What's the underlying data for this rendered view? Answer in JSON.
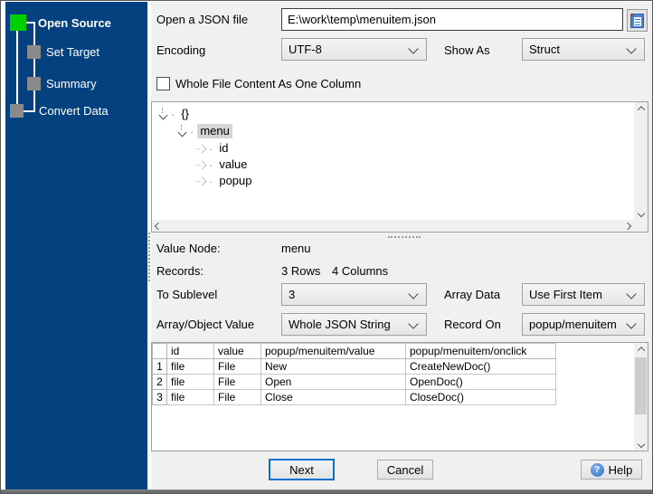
{
  "sidebar": {
    "steps": [
      {
        "label": "Open Source",
        "state": "active"
      },
      {
        "label": "Set Target",
        "state": "pending"
      },
      {
        "label": "Summary",
        "state": "pending"
      },
      {
        "label": "Convert Data",
        "state": "pending"
      }
    ]
  },
  "source": {
    "file_label": "Open a JSON file",
    "file_path": "E:\\work\\temp\\menuitem.json",
    "encoding_label": "Encoding",
    "encoding_value": "UTF-8",
    "show_as_label": "Show As",
    "show_as_value": "Struct",
    "whole_file_label": "Whole File Content As One Column",
    "whole_file_checked": false
  },
  "tree": {
    "nodes": [
      {
        "label": "{}",
        "level": 0,
        "state": "expanded",
        "selected": false
      },
      {
        "label": "menu",
        "level": 1,
        "state": "expanded",
        "selected": true
      },
      {
        "label": "id",
        "level": 2,
        "state": "collapsed",
        "selected": false
      },
      {
        "label": "value",
        "level": 2,
        "state": "collapsed",
        "selected": false
      },
      {
        "label": "popup",
        "level": 2,
        "state": "collapsed",
        "selected": false
      }
    ]
  },
  "details": {
    "value_node_label": "Value Node:",
    "value_node": "menu",
    "records_label": "Records:",
    "records_rows": "3 Rows",
    "records_columns": "4 Columns"
  },
  "options": {
    "to_sublevel_label": "To Sublevel",
    "to_sublevel_value": "3",
    "array_data_label": "Array Data",
    "array_data_value": "Use First Item",
    "array_object_label": "Array/Object Value",
    "array_object_value": "Whole JSON String",
    "record_on_label": "Record On",
    "record_on_value": "popup/menuitem"
  },
  "grid": {
    "headers": [
      "id",
      "value",
      "popup/menuitem/value",
      "popup/menuitem/onclick"
    ],
    "rows": [
      [
        "1",
        "file",
        "File",
        "New",
        "CreateNewDoc()"
      ],
      [
        "2",
        "file",
        "File",
        "Open",
        "OpenDoc()"
      ],
      [
        "3",
        "file",
        "File",
        "Close",
        "CloseDoc()"
      ]
    ]
  },
  "footer": {
    "next_label": "Next",
    "cancel_label": "Cancel",
    "help_label": "Help",
    "help_icon_glyph": "?"
  },
  "colors": {
    "sidebar_bg": "#04417e",
    "active_step_green": "#00d000",
    "inactive_step_gray": "#8a8a8a",
    "next_button_border_blue": "#0b6fce",
    "help_icon_blue": "#2f6fc2",
    "content_bg": "#f0f0f0"
  }
}
